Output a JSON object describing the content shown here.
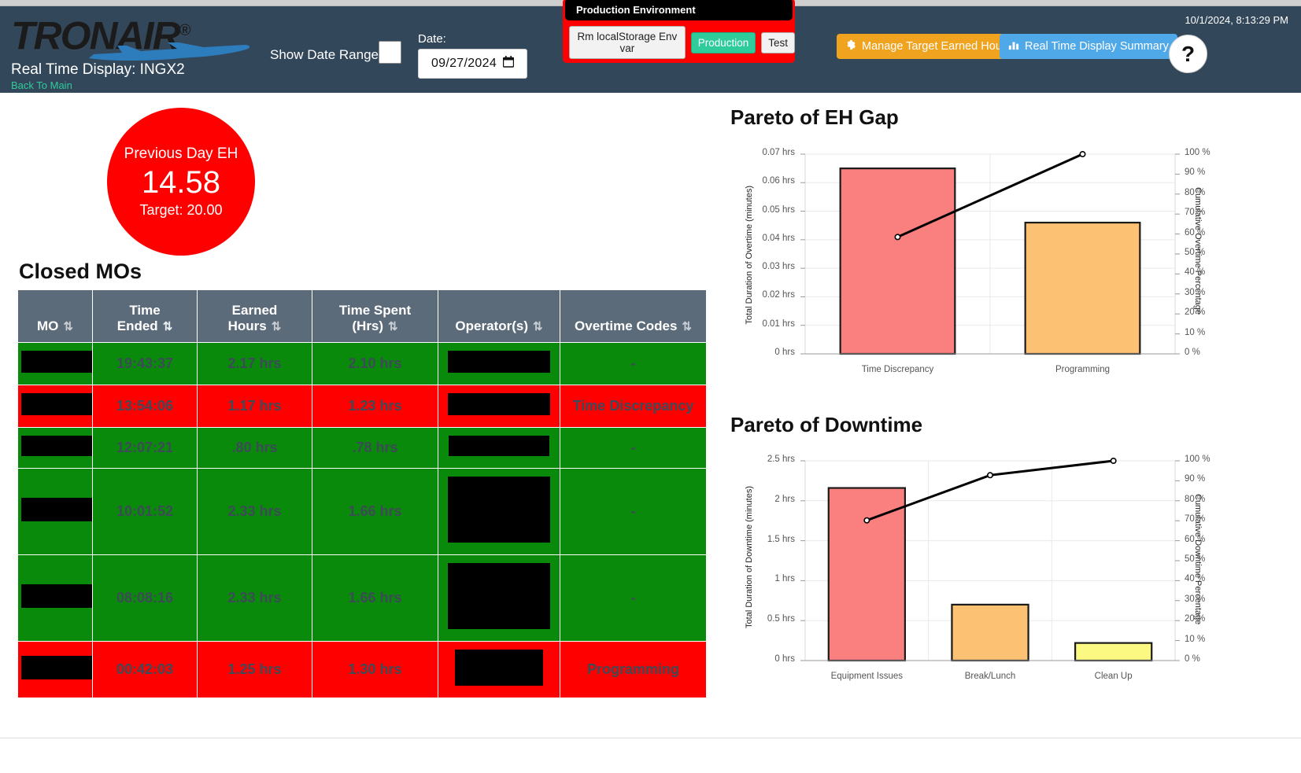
{
  "header": {
    "brand": "TRONAIR",
    "brand_reg": "®",
    "page_title": "Real Time Display: INGX2",
    "back_link": "Back To Main",
    "show_date_range_label": "Show Date Range:",
    "date_label": "Date:",
    "date_value": "09/27/2024",
    "calendar_icon": "calendar-icon",
    "timestamp": "10/1/2024, 8:13:29 PM",
    "manage_target_label": "Manage Target Earned Hours",
    "manage_target_icon": "gear-icon",
    "summary_label": "Real Time Display Summary",
    "summary_icon": "bar-chart-icon",
    "help_label": "?",
    "env": {
      "title": "Production Environment",
      "clear_btn": "Rm localStorage Env var",
      "production_btn": "Production",
      "test_btn": "Test",
      "active": "Production",
      "border_color": "#ff0000",
      "active_color": "#2ecc9b"
    },
    "colors": {
      "header_bg": "#33475b",
      "accent_orange": "#f0a31e",
      "accent_blue": "#4fa8e8",
      "link_green": "#2ecc9b"
    }
  },
  "kpi": {
    "label": "Previous Day EH",
    "value": "14.58",
    "target": "Target: 20.00",
    "color": "#ff0000"
  },
  "table": {
    "title": "Closed MOs",
    "columns": [
      {
        "line1": "",
        "line2": "MO",
        "sort": "sort-both-icon",
        "sorted": false
      },
      {
        "line1": "Time",
        "line2": "Ended",
        "sort": "sort-desc-icon",
        "sorted": true
      },
      {
        "line1": "Earned",
        "line2": "Hours",
        "sort": "sort-both-icon",
        "sorted": false
      },
      {
        "line1": "Time Spent",
        "line2": "(Hrs)",
        "sort": "sort-both-icon",
        "sorted": false
      },
      {
        "line1": "",
        "line2": "Operator(s)",
        "sort": "sort-both-icon",
        "sorted": false
      },
      {
        "line1": "",
        "line2": "Overtime Codes",
        "sort": "sort-both-icon",
        "sorted": false
      }
    ],
    "rows": [
      {
        "status": "green",
        "mo": "",
        "mo_redacted": true,
        "mo_w": 90,
        "mo_h": 28,
        "time_ended": "19:43:37",
        "earned_hours": "2.17 hrs",
        "time_spent": "2.10 hrs",
        "operator": "",
        "op_redacted": true,
        "op_w": 130,
        "op_h": 28,
        "overtime_code": "-"
      },
      {
        "status": "red",
        "mo": "",
        "mo_redacted": true,
        "mo_w": 90,
        "mo_h": 28,
        "time_ended": "13:54:06",
        "earned_hours": "1.17 hrs",
        "time_spent": "1.23 hrs",
        "operator": "",
        "op_redacted": true,
        "op_w": 130,
        "op_h": 28,
        "overtime_code": "Time Discrepancy"
      },
      {
        "status": "green",
        "mo": "",
        "mo_redacted": true,
        "mo_w": 90,
        "mo_h": 26,
        "time_ended": "12:07:21",
        "earned_hours": ".80 hrs",
        "time_spent": ".78 hrs",
        "operator": "",
        "op_redacted": true,
        "op_w": 128,
        "op_h": 26,
        "overtime_code": "-"
      },
      {
        "status": "green",
        "mo": "",
        "mo_redacted": true,
        "mo_w": 90,
        "mo_h": 30,
        "time_ended": "10:01:52",
        "earned_hours": "2.33 hrs",
        "time_spent": "1.66 hrs",
        "operator": "",
        "op_redacted": true,
        "op_w": 130,
        "op_h": 84,
        "overtime_code": "-"
      },
      {
        "status": "green",
        "mo": "",
        "mo_redacted": true,
        "mo_w": 90,
        "mo_h": 30,
        "time_ended": "08:08:16",
        "earned_hours": "2.33 hrs",
        "time_spent": "1.66 hrs",
        "operator": "",
        "op_redacted": true,
        "op_w": 130,
        "op_h": 84,
        "overtime_code": "-"
      },
      {
        "status": "red",
        "mo": "",
        "mo_redacted": true,
        "mo_w": 90,
        "mo_h": 30,
        "time_ended": "00:42:03",
        "earned_hours": "1.25 hrs",
        "time_spent": "1.30 hrs",
        "operator": "",
        "op_redacted": true,
        "op_w": 112,
        "op_h": 46,
        "overtime_code": "Programming"
      }
    ]
  },
  "chart_data": [
    {
      "id": "pareto-eh-gap",
      "type": "bar",
      "title": "Pareto of EH Gap",
      "categories": [
        "Time Discrepancy",
        "Programming"
      ],
      "values": [
        0.065,
        0.046
      ],
      "bar_colors": [
        "#fa7f7f",
        "#fcc172"
      ],
      "ylabel": "Total Duration of Overtime (minutes)",
      "xlabel": "",
      "ylim": [
        0,
        0.07
      ],
      "yticks": [
        "0 hrs",
        "0.01 hrs",
        "0.02 hrs",
        "0.03 hrs",
        "0.04 hrs",
        "0.05 hrs",
        "0.06 hrs",
        "0.07 hrs"
      ],
      "y2label": "Cumulative Overtime Percentage",
      "y2lim": [
        0,
        100
      ],
      "y2ticks": [
        "0 %",
        "10 %",
        "20 %",
        "30 %",
        "40 %",
        "50 %",
        "60 %",
        "70 %",
        "80 %",
        "90 %",
        "100 %"
      ],
      "cumulative": [
        58.5,
        100
      ],
      "line_color": "#000000",
      "grid": true,
      "legend": "none"
    },
    {
      "id": "pareto-downtime",
      "type": "bar",
      "title": "Pareto of Downtime",
      "categories": [
        "Equipment Issues",
        "Break/Lunch",
        "Clean Up"
      ],
      "values": [
        2.16,
        0.7,
        0.22
      ],
      "bar_colors": [
        "#fa7f7f",
        "#fcc172",
        "#fbf982"
      ],
      "ylabel": "Total Duration of Downtime (minutes)",
      "xlabel": "",
      "ylim": [
        0,
        2.5
      ],
      "yticks": [
        "0 hrs",
        "0.5 hrs",
        "1 hrs",
        "1.5 hrs",
        "2 hrs",
        "2.5 hrs"
      ],
      "y2label": "Cumulative Downtime Percentage",
      "y2lim": [
        0,
        100
      ],
      "y2ticks": [
        "0 %",
        "10 %",
        "20 %",
        "30 %",
        "40 %",
        "50 %",
        "60 %",
        "70 %",
        "80 %",
        "90 %",
        "100 %"
      ],
      "cumulative": [
        70.2,
        92.8,
        100
      ],
      "line_color": "#000000",
      "grid": true,
      "legend": "none"
    }
  ]
}
